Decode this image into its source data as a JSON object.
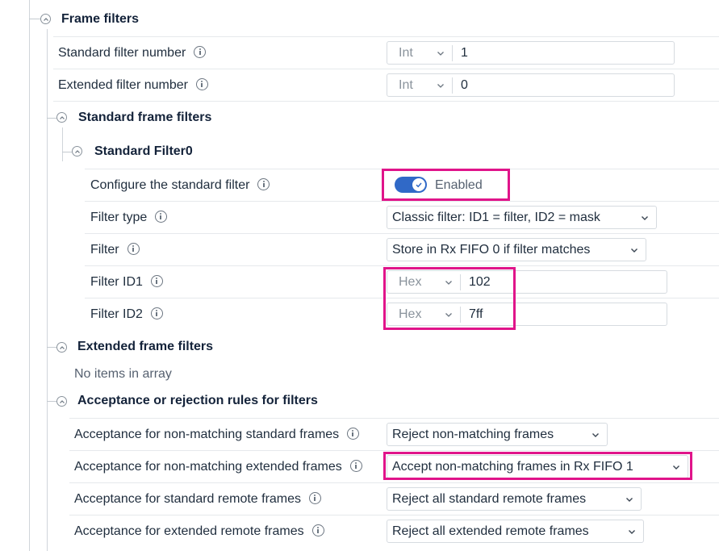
{
  "frame_filters": {
    "title": "Frame filters",
    "standard_filter_number": {
      "label": "Standard filter number",
      "type": "Int",
      "value": "1"
    },
    "extended_filter_number": {
      "label": "Extended filter number",
      "type": "Int",
      "value": "0"
    }
  },
  "standard_frame_filters": {
    "title": "Standard frame filters",
    "filter0": {
      "title": "Standard Filter0",
      "configure": {
        "label": "Configure the standard filter",
        "state": "Enabled"
      },
      "filter_type": {
        "label": "Filter type",
        "value": "Classic filter: ID1 = filter, ID2 = mask"
      },
      "filter": {
        "label": "Filter",
        "value": "Store in Rx FIFO 0 if filter matches"
      },
      "filter_id1": {
        "label": "Filter ID1",
        "type": "Hex",
        "value": "102"
      },
      "filter_id2": {
        "label": "Filter ID2",
        "type": "Hex",
        "value": "7ff"
      }
    }
  },
  "extended_frame_filters": {
    "title": "Extended frame filters",
    "empty_text": "No items in array"
  },
  "acceptance_rules": {
    "title": "Acceptance or rejection rules for filters",
    "non_matching_standard": {
      "label": "Acceptance for non-matching standard frames",
      "value": "Reject non-matching frames"
    },
    "non_matching_extended": {
      "label": "Acceptance for non-matching extended frames",
      "value": "Accept non-matching frames in Rx FIFO 1"
    },
    "standard_remote": {
      "label": "Acceptance for standard remote frames",
      "value": "Reject all standard remote frames"
    },
    "extended_remote": {
      "label": "Acceptance for extended remote frames",
      "value": "Reject all extended remote frames"
    }
  },
  "colors": {
    "highlight": "#e0148a",
    "toggle": "#3069c7"
  }
}
